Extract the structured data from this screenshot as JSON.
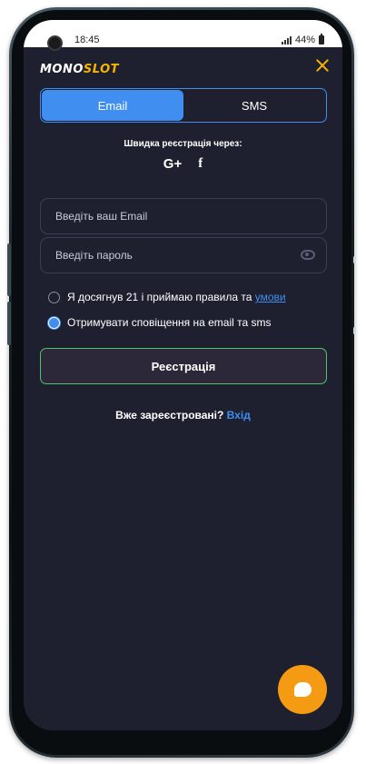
{
  "status_bar": {
    "time": "18:45",
    "battery": "44%"
  },
  "brand": {
    "logo_main": "MONO",
    "logo_accent": "SLOT",
    "accent_color": "#f5b400"
  },
  "tabs": [
    {
      "label": "Email",
      "active": true
    },
    {
      "label": "SMS",
      "active": false
    }
  ],
  "quick_register": {
    "title": "Швидка реєстрація через:",
    "icons": [
      "google-plus-icon",
      "facebook-icon"
    ],
    "google_glyph": "G+",
    "facebook_glyph": "f"
  },
  "form": {
    "email_placeholder": "Введіть ваш Email",
    "password_placeholder": "Введіть пароль",
    "age_terms_text": "Я досягнув 21 і приймаю правила та ",
    "age_terms_link": "умови",
    "age_terms_checked": false,
    "notifications_text": "Отримувати сповіщення на email та sms",
    "notifications_checked": true,
    "submit_label": "Реєстрація"
  },
  "footer": {
    "already_registered": "Вже зареєстровані?",
    "login_link": "Вхід"
  },
  "colors": {
    "background": "#1e2030",
    "primary_blue": "#3f8ef0",
    "submit_border_green": "#4fc46a",
    "chat_orange": "#f59b13"
  }
}
